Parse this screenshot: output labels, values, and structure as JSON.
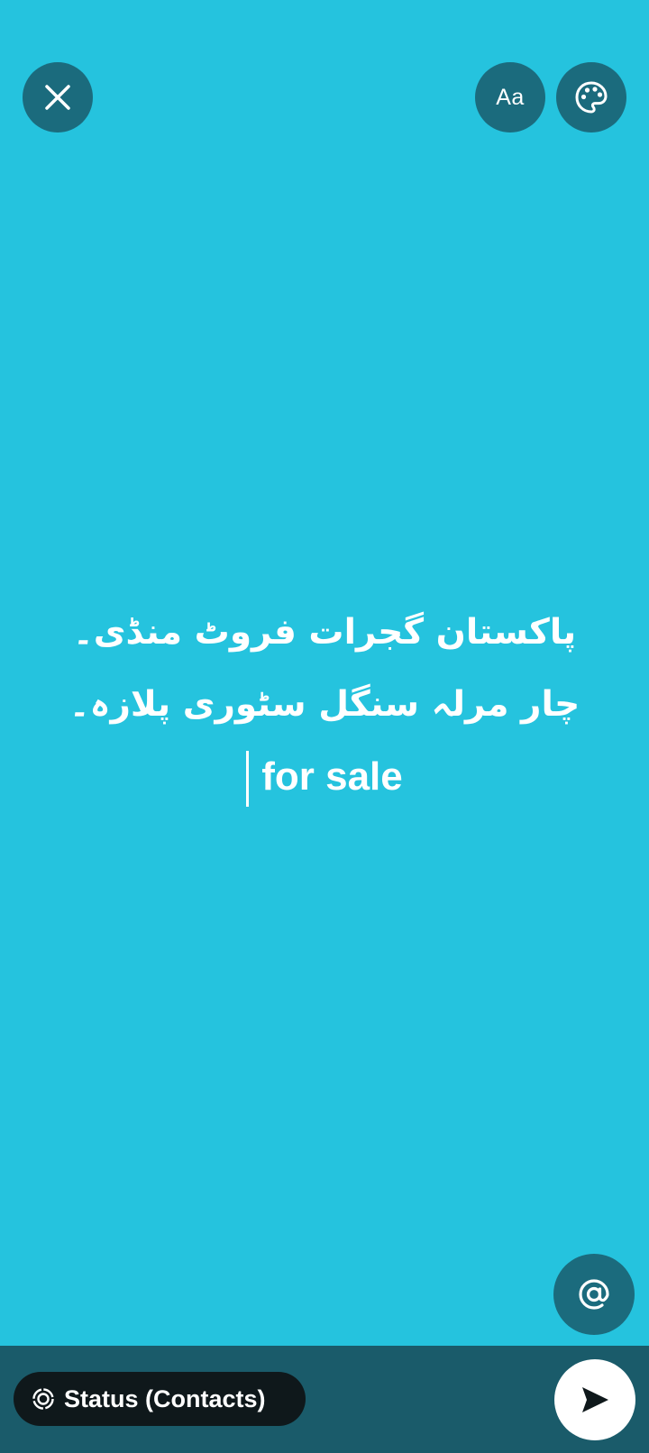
{
  "header": {
    "close_icon": "close-icon",
    "font_button_label": "Aa",
    "palette_icon": "palette-icon"
  },
  "status_text": {
    "line1": "پاکستان گجرات فروٹ منڈی۔",
    "line2": "چار مرلہ سنگل سٹوری پلازہ۔",
    "line3": "for sale"
  },
  "mention_icon": "at-sign-icon",
  "footer": {
    "audience_label": "Status (Contacts)",
    "audience_icon": "status-ring-icon",
    "send_icon": "send-icon"
  },
  "colors": {
    "background": "#25c3de",
    "button": "#1b6b7d",
    "bottom_bar": "#1a5b6a",
    "chip": "#0f181b",
    "send_button": "#ffffff"
  }
}
